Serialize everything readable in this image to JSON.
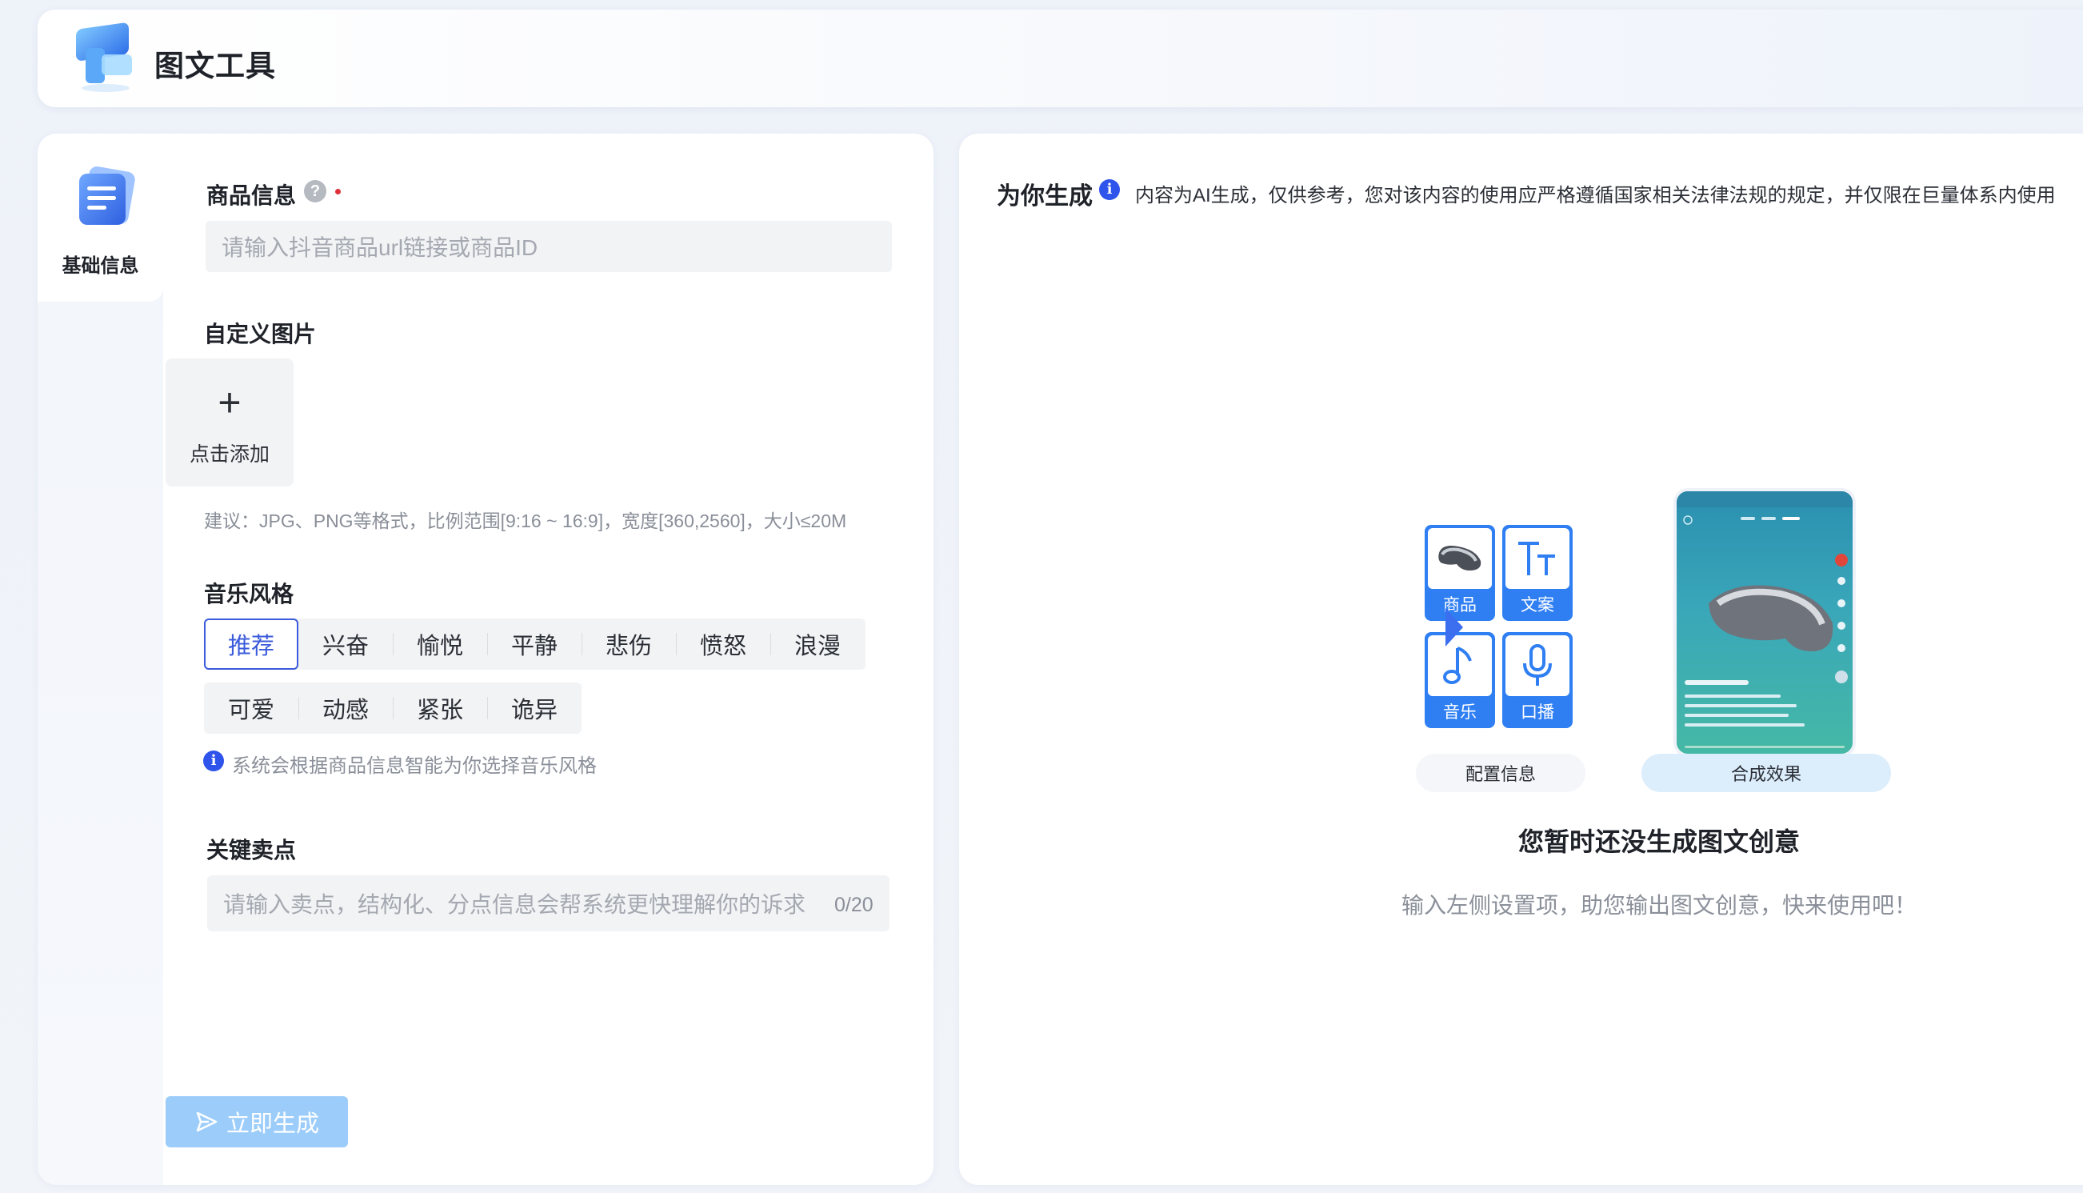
{
  "app": {
    "title": "图文工具"
  },
  "side_nav": {
    "items": [
      {
        "label": "基础信息"
      }
    ]
  },
  "form": {
    "product": {
      "label": "商品信息",
      "placeholder": "请输入抖音商品url链接或商品ID"
    },
    "custom_image": {
      "label": "自定义图片",
      "add_label": "点击添加",
      "hint": "建议：JPG、PNG等格式，比例范围[9:16 ~ 16:9]，宽度[360,2560]，大小≤20M"
    },
    "music_style": {
      "label": "音乐风格",
      "selected": "推荐",
      "options_row1": [
        "推荐",
        "兴奋",
        "愉悦",
        "平静",
        "悲伤",
        "愤怒",
        "浪漫"
      ],
      "options_row2": [
        "可爱",
        "动感",
        "紧张",
        "诡异"
      ],
      "hint": "系统会根据商品信息智能为你选择音乐风格"
    },
    "selling_points": {
      "label": "关键卖点",
      "placeholder": "请输入卖点，结构化、分点信息会帮系统更快理解你的诉求",
      "counter": "0/20"
    },
    "generate_button": "立即生成"
  },
  "result": {
    "title": "为你生成",
    "disclaimer": "内容为AI生成，仅供参考，您对该内容的使用应严格遵循国家相关法律法规的规定，并仅限在巨量体系内使用",
    "features": [
      "商品",
      "文案",
      "音乐",
      "口播"
    ],
    "step_config": "配置信息",
    "step_result": "合成效果",
    "empty_title": "您暂时还没生成图文创意",
    "empty_subtitle": "输入左侧设置项，助您输出图文创意，快来使用吧！"
  },
  "colors": {
    "accent": "#3b5bdb",
    "button_disabled": "#9ccdfa",
    "tile_blue": "#2f7ff3"
  }
}
